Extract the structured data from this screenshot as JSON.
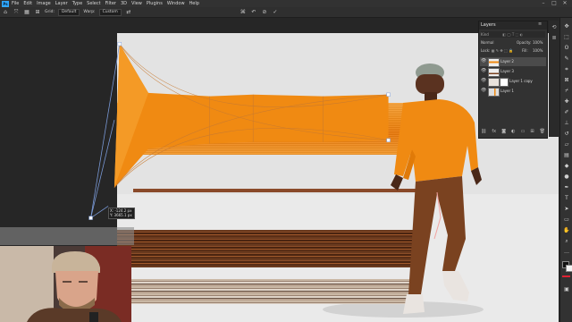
{
  "menubar": {
    "app_logo": "Ps",
    "items": [
      "File",
      "Edit",
      "Image",
      "Layer",
      "Type",
      "Select",
      "Filter",
      "3D",
      "View",
      "Plugins",
      "Window",
      "Help"
    ],
    "window_controls": {
      "minimize": "–",
      "maximize": "□",
      "close": "✕"
    }
  },
  "optionsbar": {
    "grid_label": "Grid:",
    "grid_value": "Default",
    "warp_label": "Warp:",
    "warp_value": "Custom",
    "confirm_symbol": "✓"
  },
  "transform_readout": {
    "line1": "X: -124.2 px",
    "line2": "Y: 3665.1 px"
  },
  "layers_panel": {
    "title": "Layers",
    "search_placeholder": "Kind",
    "blend_mode": "Normal",
    "opacity_label": "Opacity:",
    "opacity_value": "100%",
    "lock_label": "Lock:",
    "fill_label": "Fill:",
    "fill_value": "100%",
    "layers": [
      {
        "name": "Layer 2",
        "visible": true,
        "selected": true
      },
      {
        "name": "Layer 3",
        "visible": true,
        "selected": false
      },
      {
        "name": "Layer 1 copy",
        "visible": true,
        "selected": false
      },
      {
        "name": "Layer 1",
        "visible": true,
        "selected": false
      }
    ],
    "footer_icons": [
      "link-icon",
      "fx-icon",
      "mask-icon",
      "adjustment-icon",
      "folder-icon",
      "new-layer-icon",
      "trash-icon"
    ]
  },
  "colors": {
    "ps_blue": "#31a8ff",
    "orange_stretch": "#f18a14",
    "warp_grid": "#7a9ad8"
  }
}
